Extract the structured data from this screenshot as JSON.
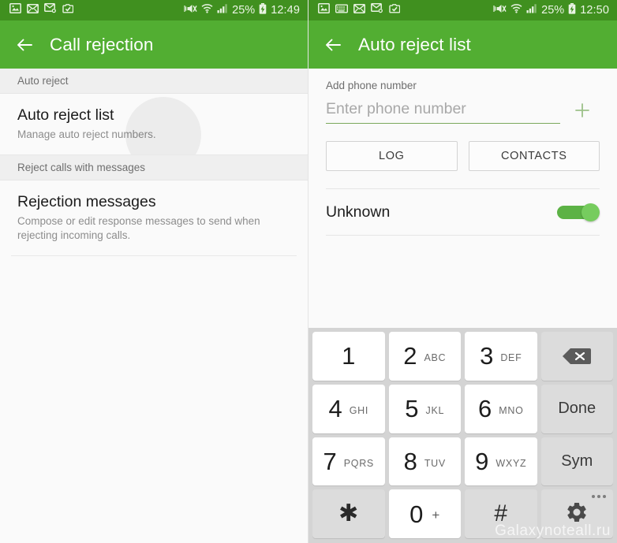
{
  "colors": {
    "appbar_green": "#52ae32",
    "statusbar_green": "#40901f",
    "toggle_on_green": "#5cb245",
    "toggle_knob_green": "#76cc5e",
    "underline_green": "#7aa85c",
    "section_header_bg": "#efefef",
    "keypad_bg": "#d4d4d4",
    "key_white": "#ffffff",
    "key_function_gray": "#dcdcdc"
  },
  "left_screen": {
    "status_bar": {
      "icons": [
        "picture-icon",
        "envelope-icon",
        "envelope-sync-icon",
        "camera-upload-icon"
      ],
      "mute_icon": "vibrate-mute-icon",
      "wifi_icon": "wifi-icon",
      "signal_icon": "signal-bars-icon",
      "battery_percent": "25%",
      "battery_icon": "battery-charging-icon",
      "time": "12:49"
    },
    "appbar": {
      "back_icon": "back-arrow-icon",
      "title": "Call rejection"
    },
    "sections": [
      {
        "header": "Auto reject",
        "rows": [
          {
            "title": "Auto reject list",
            "subtitle": "Manage auto reject numbers."
          }
        ]
      },
      {
        "header": "Reject calls with messages",
        "rows": [
          {
            "title": "Rejection messages",
            "subtitle": "Compose or edit response messages to send when rejecting incoming calls."
          }
        ]
      }
    ]
  },
  "right_screen": {
    "status_bar": {
      "icons": [
        "picture-icon",
        "keyboard-icon",
        "envelope-icon",
        "envelope-sync-icon",
        "camera-upload-icon"
      ],
      "mute_icon": "vibrate-mute-icon",
      "wifi_icon": "wifi-icon",
      "signal_icon": "signal-bars-icon",
      "battery_percent": "25%",
      "battery_icon": "battery-charging-icon",
      "time": "12:50"
    },
    "appbar": {
      "back_icon": "back-arrow-icon",
      "title": "Auto reject list"
    },
    "add_number": {
      "label": "Add phone number",
      "placeholder": "Enter phone number",
      "value": "",
      "add_icon": "plus-icon"
    },
    "buttons": {
      "log": "LOG",
      "contacts": "CONTACTS"
    },
    "unknown_row": {
      "label": "Unknown",
      "toggle_state": "on"
    },
    "keypad": {
      "rows": [
        [
          {
            "main": "1",
            "sub": "",
            "type": "digit"
          },
          {
            "main": "2",
            "sub": "ABC",
            "type": "digit"
          },
          {
            "main": "3",
            "sub": "DEF",
            "type": "digit"
          },
          {
            "main": "",
            "sub": "",
            "type": "backspace",
            "icon": "backspace-icon"
          }
        ],
        [
          {
            "main": "4",
            "sub": "GHI",
            "type": "digit"
          },
          {
            "main": "5",
            "sub": "JKL",
            "type": "digit"
          },
          {
            "main": "6",
            "sub": "MNO",
            "type": "digit"
          },
          {
            "main": "Done",
            "sub": "",
            "type": "word"
          }
        ],
        [
          {
            "main": "7",
            "sub": "PQRS",
            "type": "digit"
          },
          {
            "main": "8",
            "sub": "TUV",
            "type": "digit"
          },
          {
            "main": "9",
            "sub": "WXYZ",
            "type": "digit"
          },
          {
            "main": "Sym",
            "sub": "",
            "type": "word"
          }
        ],
        [
          {
            "main": "✱",
            "sub": "",
            "type": "symbol"
          },
          {
            "main": "0",
            "sub": "+",
            "type": "digit"
          },
          {
            "main": "#",
            "sub": "",
            "type": "symbol"
          },
          {
            "main": "",
            "sub": "",
            "type": "settings",
            "icon": "gear-icon"
          }
        ]
      ]
    },
    "watermark": "Galaxynoteall.ru"
  }
}
